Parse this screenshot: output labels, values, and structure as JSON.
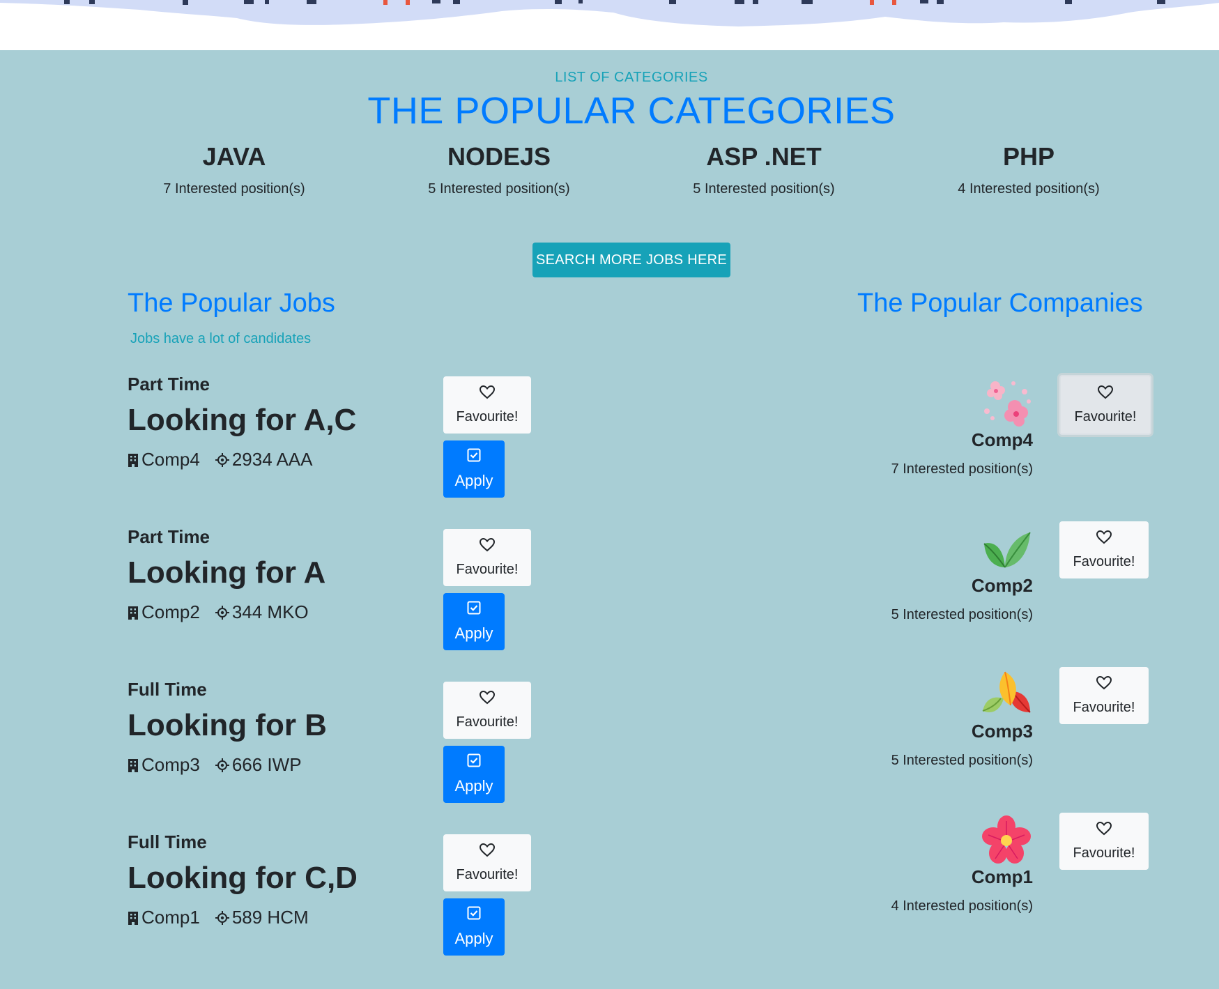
{
  "categories_section": {
    "kicker": "LIST OF CATEGORIES",
    "title": "THE POPULAR CATEGORIES",
    "items": [
      {
        "name": "JAVA",
        "count": "7 Interested position(s)"
      },
      {
        "name": "NODEJS",
        "count": "5 Interested position(s)"
      },
      {
        "name": "ASP .NET",
        "count": "5 Interested position(s)"
      },
      {
        "name": "PHP",
        "count": "4 Interested position(s)"
      }
    ],
    "search_button": "SEARCH MORE JOBS HERE"
  },
  "jobs_section": {
    "title": "The Popular Jobs",
    "subtitle": "Jobs have a lot of candidates",
    "favourite_label": "Favourite!",
    "apply_label": "Apply",
    "jobs": [
      {
        "type": "Part Time",
        "title": "Looking for A,C",
        "company": "Comp4",
        "location": "2934 AAA"
      },
      {
        "type": "Part Time",
        "title": "Looking for A",
        "company": "Comp2",
        "location": "344 MKO"
      },
      {
        "type": "Full Time",
        "title": "Looking for B",
        "company": "Comp3",
        "location": "666 IWP"
      },
      {
        "type": "Full Time",
        "title": "Looking for C,D",
        "company": "Comp1",
        "location": "589 HCM"
      }
    ]
  },
  "companies_section": {
    "title": "The Popular Companies",
    "favourite_label": "Favourite!",
    "companies": [
      {
        "name": "Comp4",
        "count": "7 Interested position(s)",
        "logo": "cherry-blossom-icon"
      },
      {
        "name": "Comp2",
        "count": "5 Interested position(s)",
        "logo": "green-leaves-icon"
      },
      {
        "name": "Comp3",
        "count": "5 Interested position(s)",
        "logo": "autumn-leaves-icon"
      },
      {
        "name": "Comp1",
        "count": "4 Interested position(s)",
        "logo": "pink-flower-icon"
      }
    ]
  },
  "colors": {
    "background": "#a8ced5",
    "primary": "#007bff",
    "info": "#17a2b8",
    "text": "#212529",
    "light_button": "#f8f9fa"
  }
}
